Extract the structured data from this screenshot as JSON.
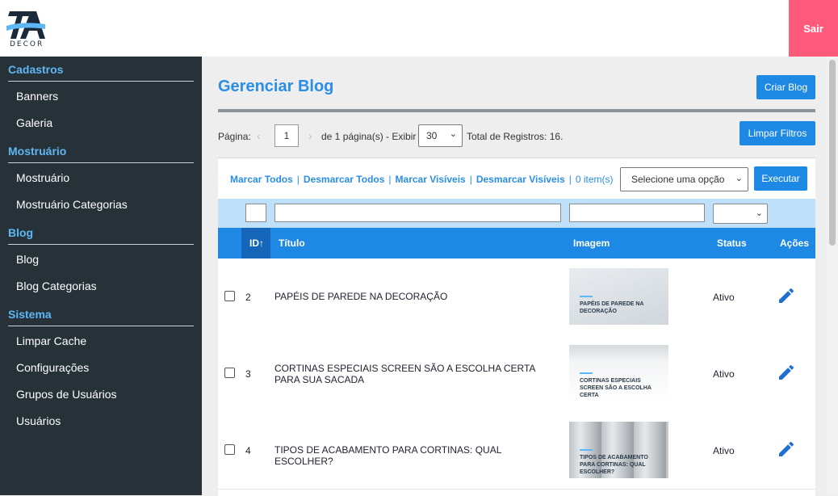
{
  "header": {
    "logo_text": "DECOR",
    "logout_label": "Sair"
  },
  "sidebar": {
    "sections": [
      {
        "title": "Cadastros",
        "items": [
          "Banners",
          "Galeria"
        ]
      },
      {
        "title": "Mostruário",
        "items": [
          "Mostruário",
          "Mostruário Categorias"
        ]
      },
      {
        "title": "Blog",
        "items": [
          "Blog",
          "Blog Categorias"
        ]
      },
      {
        "title": "Sistema",
        "items": [
          "Limpar Cache",
          "Configurações",
          "Grupos de Usuários",
          "Usuários"
        ]
      }
    ]
  },
  "main": {
    "title": "Gerenciar Blog",
    "create_label": "Criar Blog",
    "clear_filters_label": "Limpar Filtros",
    "pager": {
      "page_label": "Página:",
      "current_page": "1",
      "of_pages": "de 1 página(s) - Exibir",
      "per_page": "30",
      "total": "Total de Registros: 16."
    },
    "bulk": {
      "mark_all": "Marcar Todos",
      "unmark_all": "Desmarcar Todos",
      "mark_visible": "Marcar Visíveis",
      "unmark_visible": "Desmarcar Visíveis",
      "count": "0 item(s)",
      "select_placeholder": "Selecione uma opção",
      "execute_label": "Executar"
    },
    "columns": {
      "id": "ID",
      "title": "Título",
      "image": "Imagem",
      "status": "Status",
      "actions": "Ações"
    },
    "rows": [
      {
        "id": "2",
        "title": "PAPÉIS DE PAREDE NA DECORAÇÃO",
        "thumb_caption": "PAPÉIS DE PAREDE NA DECORAÇÃO",
        "status": "Ativo"
      },
      {
        "id": "3",
        "title": "CORTINAS ESPECIAIS SCREEN SÃO A ESCOLHA CERTA PARA SUA SACADA",
        "thumb_caption": "CORTINAS ESPECIAIS SCREEN SÃO A ESCOLHA CERTA",
        "status": "Ativo"
      },
      {
        "id": "4",
        "title": "TIPOS DE ACABAMENTO PARA CORTINAS: QUAL ESCOLHER?",
        "thumb_caption": "TIPOS DE ACABAMENTO PARA CORTINAS: QUAL ESCOLHER?",
        "status": "Ativo"
      }
    ]
  },
  "colors": {
    "accent": "#1e88e5",
    "sidebar_bg": "#273238",
    "logout_bg": "#ff5a7a",
    "filter_bg": "#bfe0fa"
  }
}
